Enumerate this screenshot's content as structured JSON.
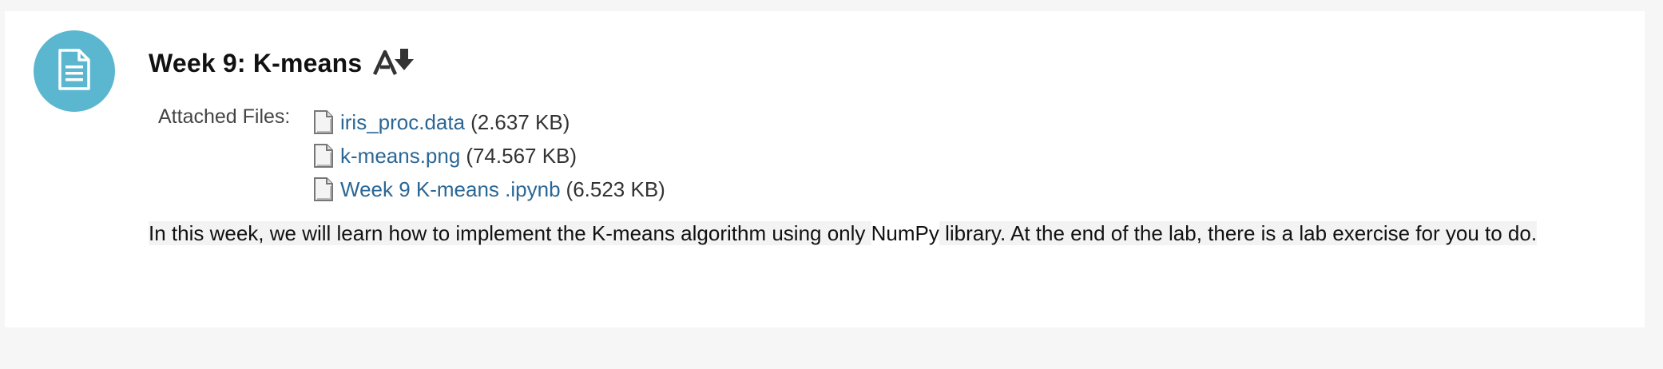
{
  "activity": {
    "icon": "document-icon",
    "title": "Week 9: K-means",
    "mark_icon": "mark-as-read-arrow-icon"
  },
  "attachments": {
    "label": "Attached Files:",
    "files": [
      {
        "name": "iris_proc.data",
        "size": "(2.637 KB)",
        "icon": "file-icon"
      },
      {
        "name": "k-means.png",
        "size": "(74.567 KB)",
        "icon": "file-icon"
      },
      {
        "name": "Week 9 K-means .ipynb",
        "size": "(6.523 KB)",
        "icon": "file-icon"
      }
    ]
  },
  "description": {
    "part1": "In this week, we will learn how to implement the K-means algorithm using only ",
    "part2": "NumPy",
    "part3": " library. At the end of the lab, there is a lab exercise for you to do."
  },
  "colors": {
    "accent_circle": "#5bb7d0",
    "link": "#2b6795",
    "background": "#f6f6f6",
    "card": "#ffffff"
  }
}
